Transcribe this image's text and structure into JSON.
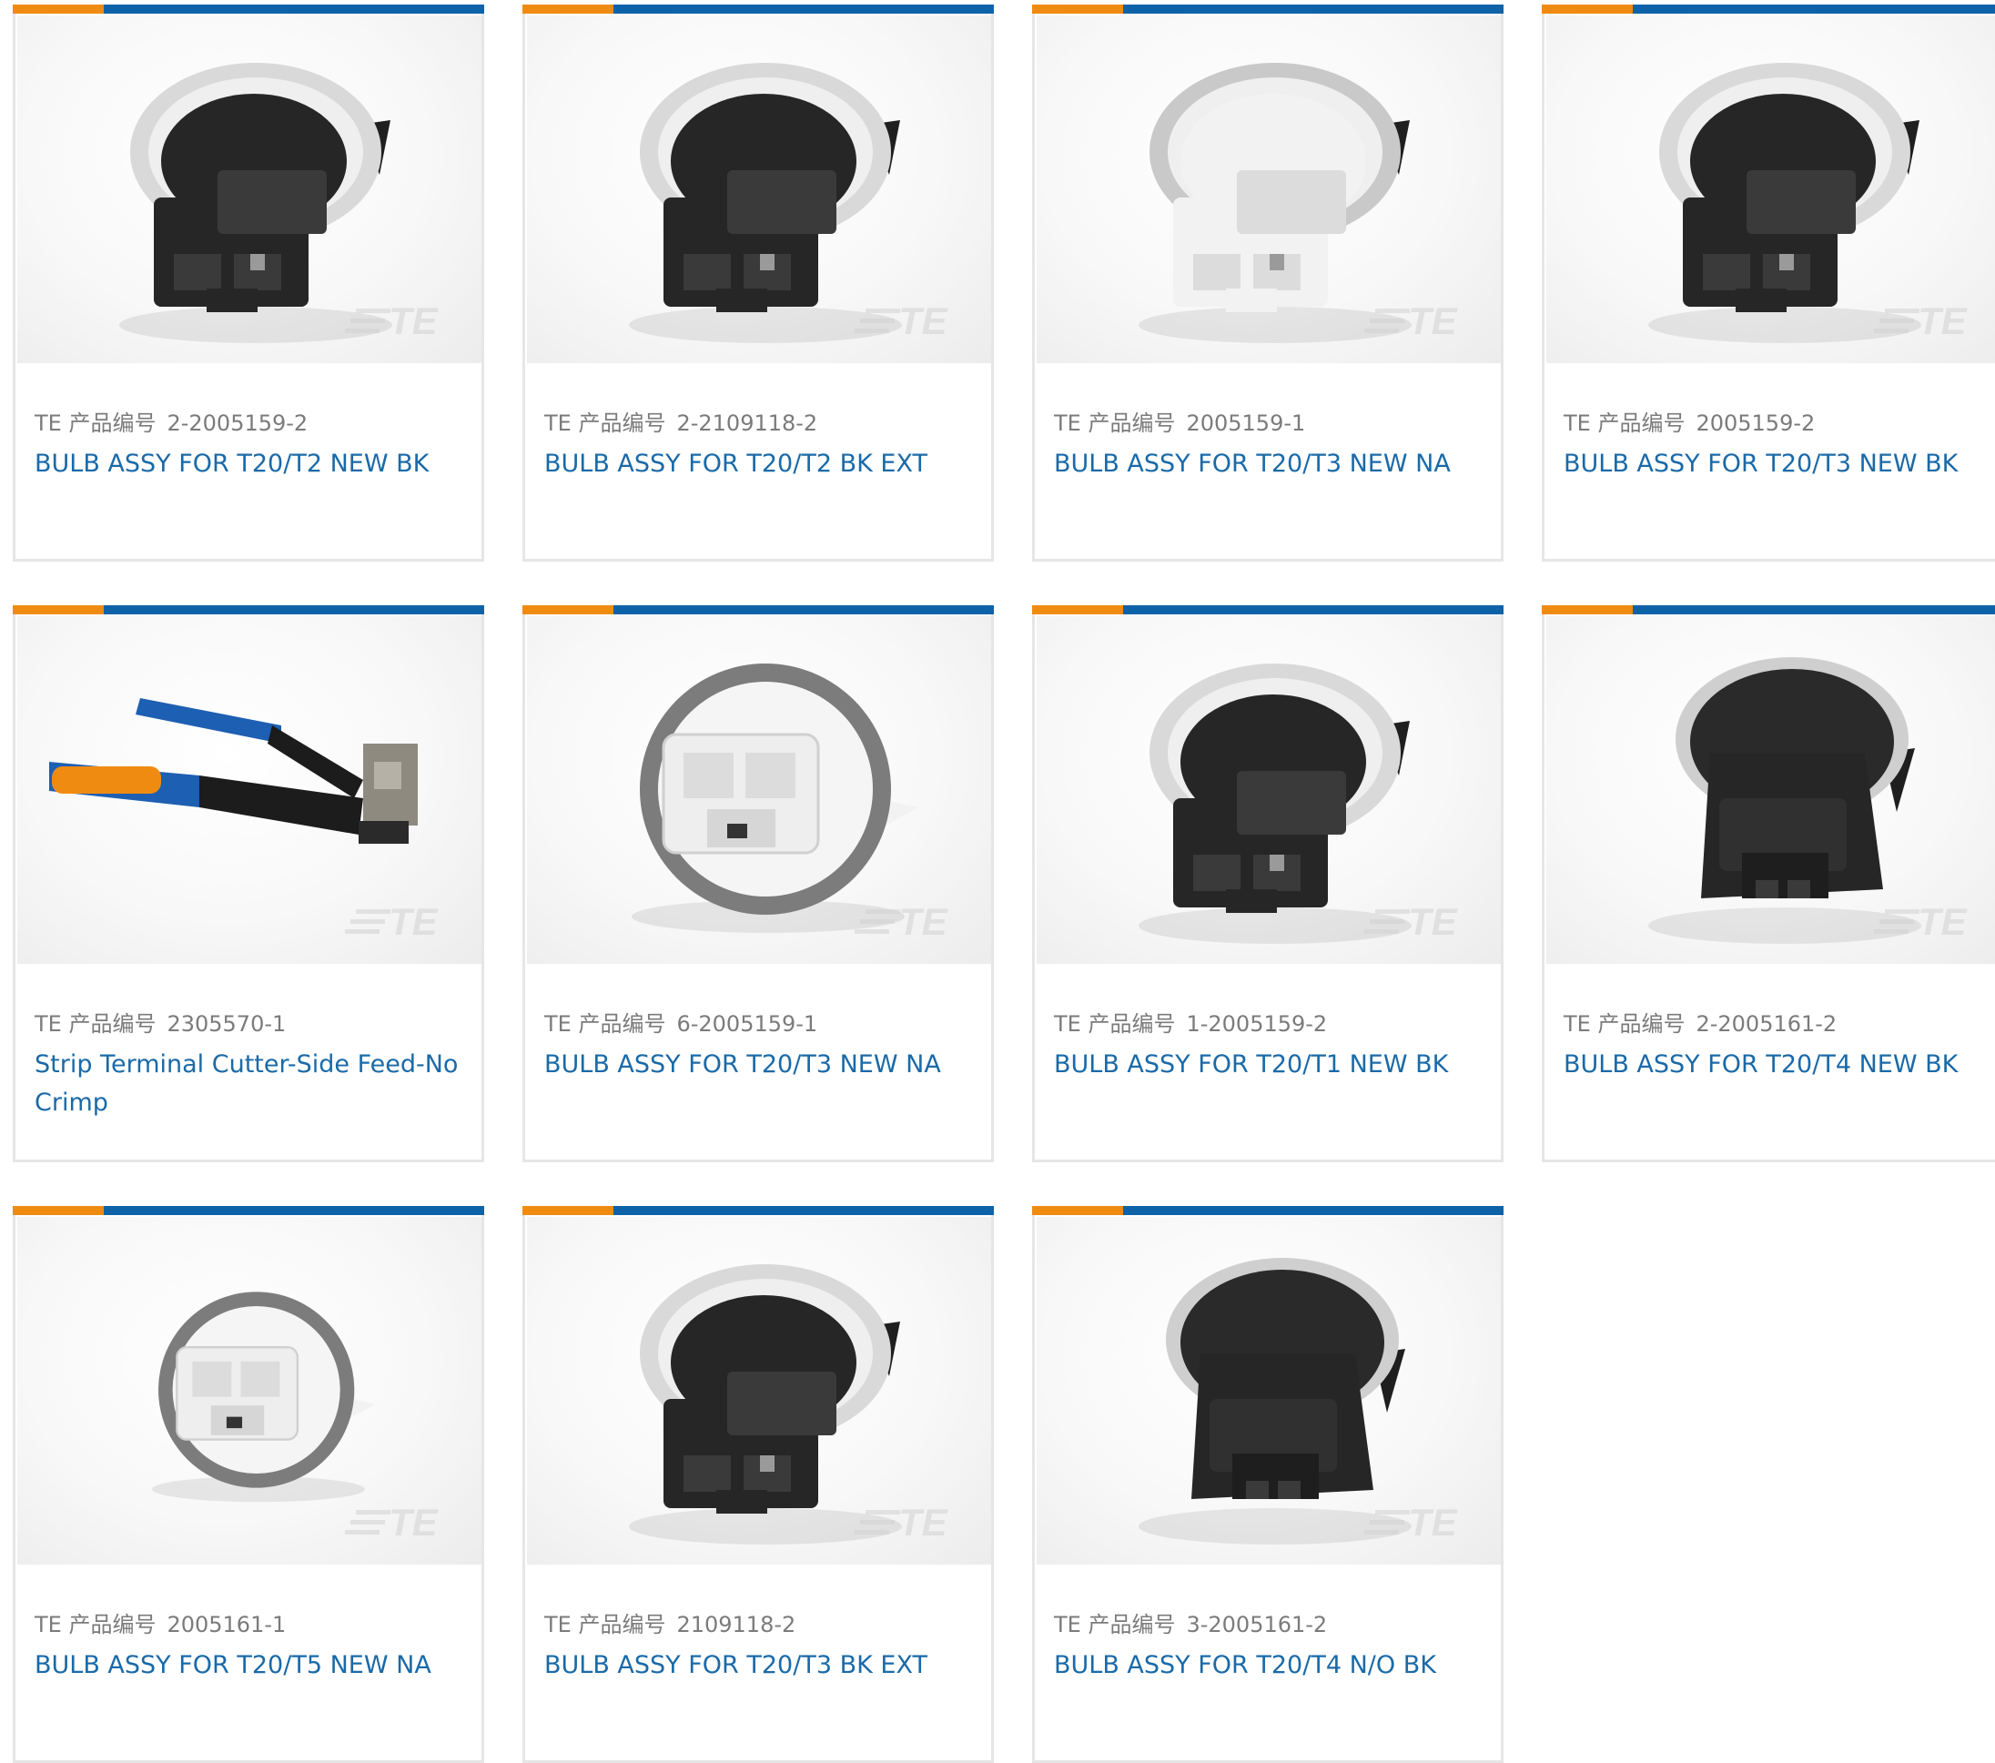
{
  "colors": {
    "accent_orange": "#f08b12",
    "accent_blue": "#0e63a8",
    "link_blue": "#1a6aa8",
    "meta_gray": "#7b7b7b",
    "border_gray": "#e6e6e6"
  },
  "label_prefix": "TE 产品编号",
  "watermark": "TE",
  "products": [
    {
      "part_number": "2-2005159-2",
      "title": "BULB ASSY FOR T20/T2 NEW BK",
      "image": "socket-black-gray-ring"
    },
    {
      "part_number": "2-2109118-2",
      "title": "BULB ASSY FOR T20/T2 BK EXT",
      "image": "socket-black-gray-ring"
    },
    {
      "part_number": "2005159-1",
      "title": "BULB ASSY FOR T20/T3 NEW NA",
      "image": "socket-white"
    },
    {
      "part_number": "2005159-2",
      "title": "BULB ASSY FOR T20/T3 NEW BK",
      "image": "socket-black-gray-ring"
    },
    {
      "part_number": "2305570-1",
      "title": "Strip Terminal Cutter-Side Feed-No Crimp",
      "image": "crimp-tool"
    },
    {
      "part_number": "6-2005159-1",
      "title": "BULB ASSY FOR T20/T3 NEW NA",
      "image": "socket-white-front"
    },
    {
      "part_number": "1-2005159-2",
      "title": "BULB ASSY FOR T20/T1 NEW BK",
      "image": "socket-black-gray-ring"
    },
    {
      "part_number": "2-2005161-2",
      "title": "BULB ASSY FOR T20/T4 NEW BK",
      "image": "socket-black-tall"
    },
    {
      "part_number": "2005161-1",
      "title": "BULB ASSY FOR T20/T5 NEW NA",
      "image": "socket-white-small"
    },
    {
      "part_number": "2109118-2",
      "title": "BULB ASSY FOR T20/T3 BK EXT",
      "image": "socket-black-gray-ring"
    },
    {
      "part_number": "3-2005161-2",
      "title": "BULB ASSY FOR T20/T4 N/O BK",
      "image": "socket-black-tall"
    }
  ]
}
